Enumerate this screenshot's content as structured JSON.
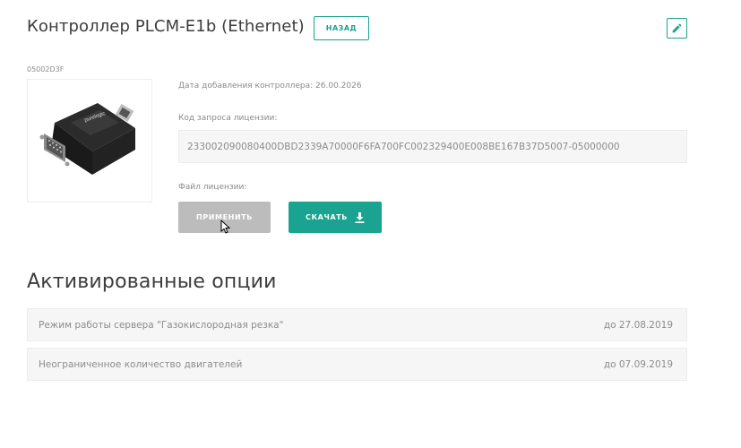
{
  "header": {
    "title": "Контроллер PLCM-E1b (Ethernet)",
    "back_label": "НАЗАД"
  },
  "controller": {
    "serial": "05002D3F",
    "date_added_label": "Дата добавления контроллера:",
    "date_added_value": "26.00.2026",
    "license_request_label": "Код запроса лицензии:",
    "license_request_code": "233002090080400DBD2339A70000F6FA700FC002329400E008BE167B37D5007-05000000",
    "license_file_label": "Файл лицензии:",
    "apply_label": "ПРИМЕНИТЬ",
    "download_label": "СКАЧАТЬ"
  },
  "options": {
    "title": "Активированные опции",
    "items": [
      {
        "name": "Режим работы сервера \"Газокислородная резка\"",
        "until": "до 27.08.2019"
      },
      {
        "name": "Неограниченное количество двигателей",
        "until": "до 07.09.2019"
      }
    ]
  },
  "colors": {
    "accent": "#1aa391",
    "disabled_button": "#bcbcbc",
    "field_background": "#f6f6f6"
  },
  "icons": {
    "edit": "pencil-icon",
    "download": "download-icon",
    "cursor": "mouse-pointer-icon"
  }
}
